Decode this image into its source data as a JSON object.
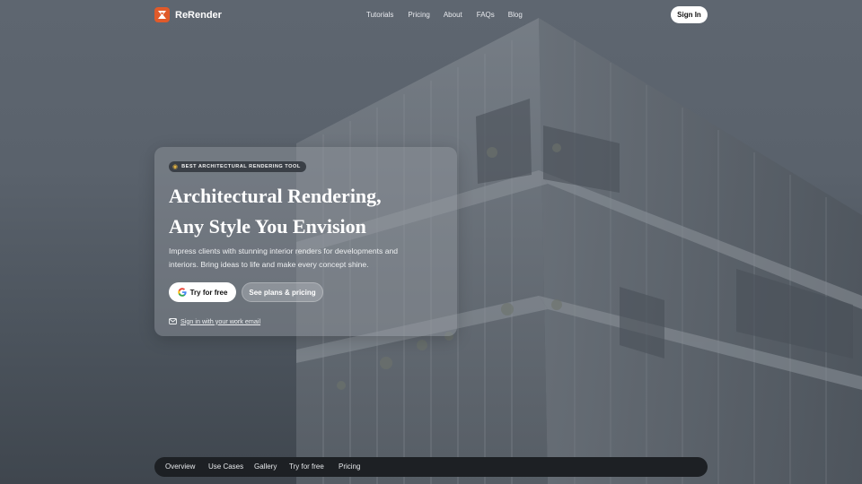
{
  "brand": {
    "name": "ReRender"
  },
  "nav": {
    "links": [
      "Tutorials",
      "Pricing",
      "About",
      "FAQs",
      "Blog"
    ],
    "signin_label": "Sign In"
  },
  "hero": {
    "badge": "BEST ARCHITECTURAL RENDERING TOOL",
    "title_line1": "Architectural Rendering,",
    "title_line2": "Any Style You Envision",
    "description_line1": "Impress clients with stunning interior renders for developments and",
    "description_line2": "interiors. Bring ideas to life and make every concept shine.",
    "try_label": "Try for free",
    "plans_label": "See plans & pricing",
    "email_label": "Sign in with your work email"
  },
  "tabs": [
    "Overview",
    "Use Cases",
    "Gallery",
    "Try for free",
    "Pricing"
  ],
  "colors": {
    "accent": "#e05a2a",
    "tabbar": "#1d2024",
    "background": "#5f6670"
  },
  "icons": [
    "rerender-logo-icon",
    "medal-icon",
    "google-icon",
    "mail-icon"
  ]
}
